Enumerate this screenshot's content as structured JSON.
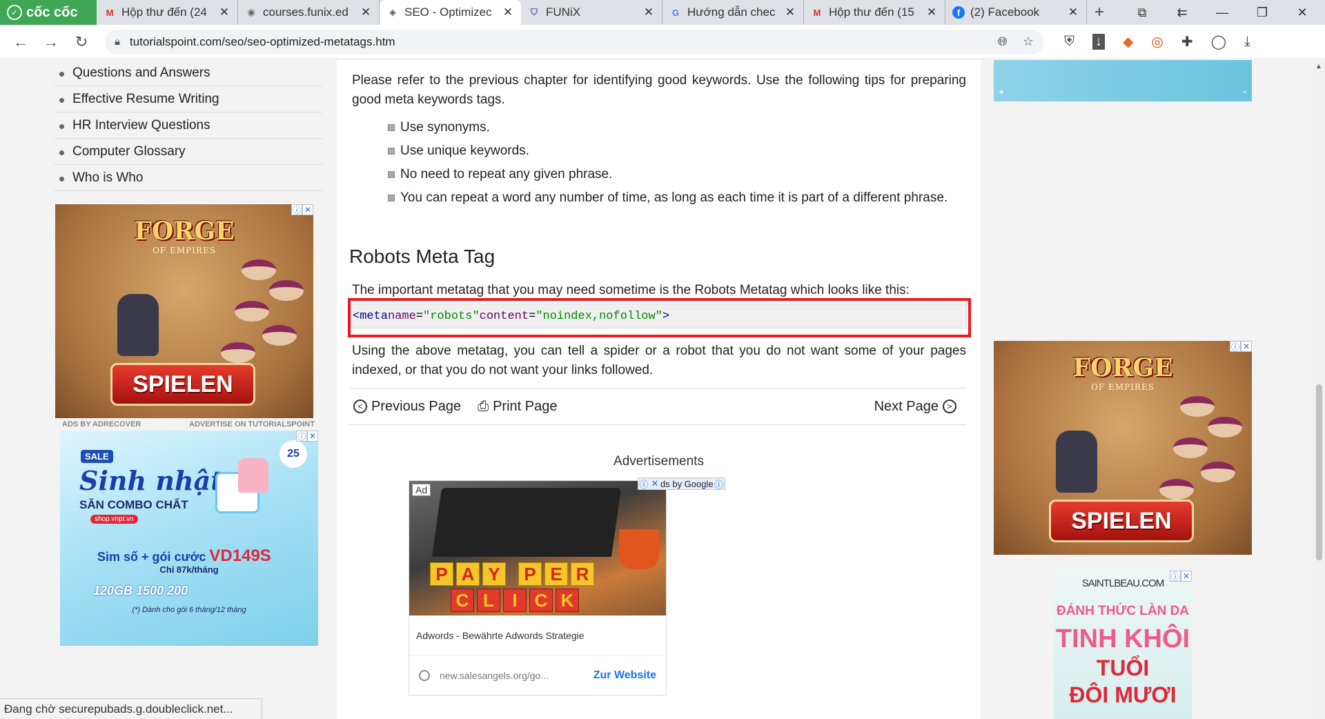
{
  "browser": {
    "brand": "cốc cốc",
    "tabs": [
      {
        "favicon": "gmail-icon",
        "title": "Hộp thư đến (24",
        "active": false
      },
      {
        "favicon": "globe-icon",
        "title": "courses.funix.ed",
        "active": false
      },
      {
        "favicon": "tutorialspoint-icon",
        "title": "SEO - Optimizec",
        "active": true
      },
      {
        "favicon": "funix-shield-icon",
        "title": "FUNiX",
        "active": false
      },
      {
        "favicon": "google-icon",
        "title": "Hướng dẫn chec",
        "active": false
      },
      {
        "favicon": "gmail-icon",
        "title": "Hộp thư đến (15",
        "active": false
      },
      {
        "favicon": "facebook-icon",
        "title": "(2) Facebook",
        "active": false
      }
    ],
    "url": "tutorialspoint.com/seo/seo-optimized-metatags.htm",
    "status_text": "Đang chờ securepubads.g.doubleclick.net..."
  },
  "sidebar": {
    "items": [
      "Questions and Answers",
      "Effective Resume Writing",
      "HR Interview Questions",
      "Computer Glossary",
      "Who is Who"
    ]
  },
  "ads": {
    "forge_title": "FORGE",
    "forge_sub": "OF EMPIRES",
    "forge_cta": "SPIELEN",
    "ads_by": "ADS BY ADRECOVER",
    "advertise": "ADVERTISE ON TUTORIALSPOINT",
    "vnpt": {
      "sale": "SALE",
      "headline": "Sinh nhật",
      "combo": "SĂN COMBO CHẤT",
      "shop": "shop.vnpt.vn",
      "line1": "Sim số + gói cước",
      "code": "VD149S",
      "price": "Chỉ 87k/tháng",
      "features": "120GB   1500   200",
      "note": "(*) Dành cho gói 6 tháng/12 tháng",
      "badge": "25"
    },
    "google_label": "Ad",
    "by_google": "ds by Google",
    "google_headline": "Adwords - Bewährte Adwords Strategie",
    "google_domain": "new.salesangels.org/go...",
    "google_cta": "Zur Website",
    "paywords_top": [
      "P",
      "A",
      "Y",
      "P",
      "E",
      "R"
    ],
    "paywords_bottom": [
      "C",
      "L",
      "I",
      "C",
      "K"
    ],
    "saint": {
      "brand": "SAINTLBEAU.COM",
      "t1": "ĐÁNH THỨC LÀN DA",
      "t2": "TINH KHÔI",
      "t3": "TUỔI",
      "t4": "ĐÔI MƯƠI"
    }
  },
  "content": {
    "intro": "Please refer to the previous chapter for identifying good keywords. Use the following tips for preparing good meta keywords tags.",
    "tips": [
      "Use synonyms.",
      "Use unique keywords.",
      "No need to repeat any given phrase.",
      "You can repeat a word any number of time, as long as each time it is part of a different phrase."
    ],
    "heading": "Robots Meta Tag",
    "robots_intro": "The important metatag that you may need sometime is the Robots Metatag which looks like this:",
    "code": {
      "tag_open": "<meta",
      "attr1": "name",
      "val1": "\"robots\"",
      "attr2": "content",
      "val2": "\"noindex,nofollow\"",
      "tag_close": ">"
    },
    "after_code": "Using the above metatag, you can tell a spider or a robot that you do not want some of your pages indexed, or that you do not want your links followed.",
    "prev": "Previous Page",
    "print": "Print Page",
    "next": "Next Page",
    "advertisements": "Advertisements"
  }
}
